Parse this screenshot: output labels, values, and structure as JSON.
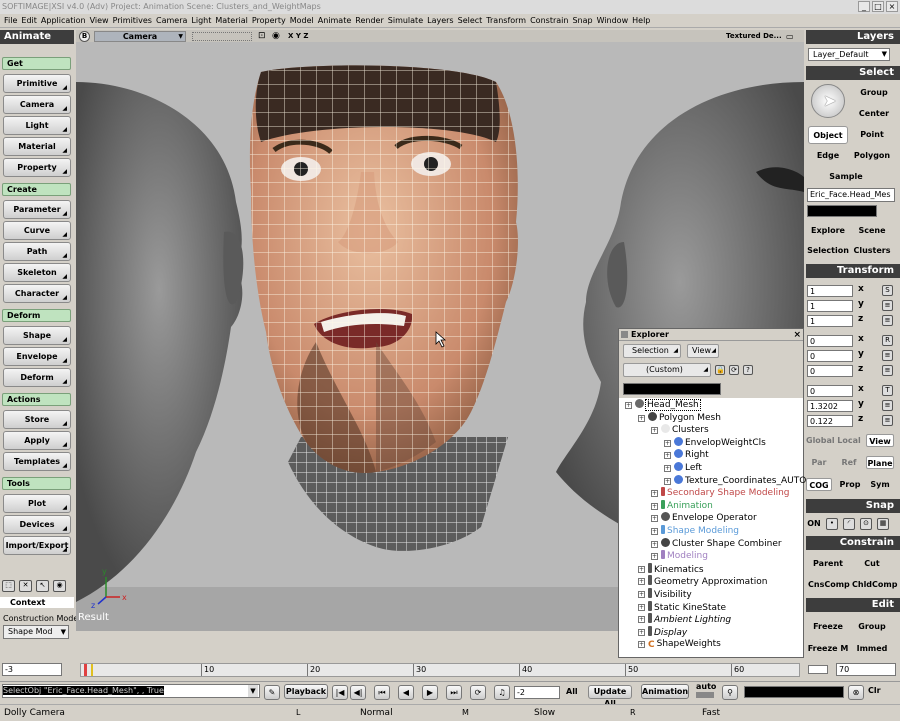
{
  "window": {
    "title": "SOFTIMAGE|XSI v4.0 (Adv) Project: Animation   Scene: Clusters_and_WeightMaps",
    "min": "_",
    "max": "□",
    "close": "×"
  },
  "menu": [
    "File",
    "Edit",
    "Application",
    "View",
    "Primitives",
    "Camera",
    "Light",
    "Material",
    "Property",
    "Model",
    "Animate",
    "Render",
    "Simulate",
    "Layers",
    "Select",
    "Transform",
    "Constrain",
    "Snap",
    "Window",
    "Help"
  ],
  "left": {
    "mode": "Animate",
    "get": {
      "label": "Get",
      "buttons": [
        "Primitive",
        "Camera",
        "Light",
        "Material",
        "Property"
      ]
    },
    "create": {
      "label": "Create",
      "buttons": [
        "Parameter",
        "Curve",
        "Path",
        "Skeleton",
        "Character"
      ]
    },
    "deform": {
      "label": "Deform",
      "buttons": [
        "Shape",
        "Envelope",
        "Deform"
      ]
    },
    "actions": {
      "label": "Actions",
      "buttons": [
        "Store",
        "Apply",
        "Templates"
      ]
    },
    "tools": {
      "label": "Tools",
      "buttons": [
        "Plot",
        "Devices",
        "Import/Export"
      ]
    },
    "context": "Context",
    "construction_mode_label": "Construction Mode",
    "construction_mode_value": "Shape Mod"
  },
  "viewport": {
    "badge": "B",
    "camera": "Camera",
    "xyz": "X Y Z",
    "display": "Textured De...",
    "result": "Result"
  },
  "right": {
    "layers": "Layers",
    "layer_default": "Layer_Default",
    "select": "Select",
    "group": "Group",
    "center": "Center",
    "object": "Object",
    "point": "Point",
    "edge": "Edge",
    "polygon": "Polygon",
    "sample": "Sample",
    "selected_name": "Eric_Face.Head_Mes",
    "explore": "Explore",
    "scene": "Scene",
    "selection": "Selection",
    "clusters": "Clusters",
    "transform": "Transform",
    "scale": [
      "1",
      "1",
      "1"
    ],
    "rotation": [
      "0",
      "0",
      "0"
    ],
    "translation": [
      "0",
      "1.3202",
      "0.122"
    ],
    "axes": [
      "x",
      "y",
      "z"
    ],
    "global": "Global",
    "local": "Local",
    "view": "View",
    "par": "Par",
    "ref": "Ref",
    "plane": "Plane",
    "cog": "COG",
    "prop": "Prop",
    "sym": "Sym",
    "snap": "Snap",
    "on": "ON",
    "constrain": "Constrain",
    "parent": "Parent",
    "cut": "Cut",
    "cnscomp": "CnsComp",
    "chldcomp": "ChldComp",
    "edit": "Edit",
    "freeze": "Freeze",
    "group2": "Group",
    "freeze_m": "Freeze M",
    "immed": "Immed"
  },
  "explorer": {
    "title": "Explorer",
    "selection": "Selection",
    "view": "View",
    "filter": "(Custom)",
    "tree": [
      {
        "label": "Head_Mesh",
        "indent": 0,
        "color": "#000000",
        "icon": "model-icon",
        "selected": true
      },
      {
        "label": "Polygon Mesh",
        "indent": 1,
        "color": "#000000",
        "icon": "gear-icon"
      },
      {
        "label": "Clusters",
        "indent": 2,
        "color": "#000000",
        "icon": "folder-icon"
      },
      {
        "label": "EnvelopWeightCls",
        "indent": 3,
        "color": "#000000",
        "icon": "cluster-icon"
      },
      {
        "label": "Right",
        "indent": 3,
        "color": "#000000",
        "icon": "cluster-icon"
      },
      {
        "label": "Left",
        "indent": 3,
        "color": "#000000",
        "icon": "cluster-icon"
      },
      {
        "label": "Texture_Coordinates_AUTO",
        "indent": 3,
        "color": "#000000",
        "icon": "cluster-icon"
      },
      {
        "label": "Secondary Shape Modeling",
        "indent": 2,
        "color": "#c04848",
        "icon": "marker-icon"
      },
      {
        "label": "Animation",
        "indent": 2,
        "color": "#3aa05a",
        "icon": "marker-icon"
      },
      {
        "label": "Envelope Operator",
        "indent": 2,
        "color": "#000000",
        "icon": "operator-icon"
      },
      {
        "label": "Shape Modeling",
        "indent": 2,
        "color": "#5a9ad8",
        "icon": "marker-icon"
      },
      {
        "label": "Cluster Shape Combiner",
        "indent": 2,
        "color": "#000000",
        "icon": "gear-icon"
      },
      {
        "label": "Modeling",
        "indent": 2,
        "color": "#a080c0",
        "icon": "marker-icon"
      },
      {
        "label": "Kinematics",
        "indent": 1,
        "color": "#000000",
        "icon": "prop-icon"
      },
      {
        "label": "Geometry Approximation",
        "indent": 1,
        "color": "#000000",
        "icon": "prop-icon"
      },
      {
        "label": "Visibility",
        "indent": 1,
        "color": "#000000",
        "icon": "prop-icon"
      },
      {
        "label": "Static KineState",
        "indent": 1,
        "color": "#000000",
        "icon": "prop-icon"
      },
      {
        "label": "Ambient Lighting",
        "indent": 1,
        "color": "#000000",
        "icon": "prop-icon",
        "italic": true
      },
      {
        "label": "Display",
        "indent": 1,
        "color": "#000000",
        "icon": "prop-icon",
        "italic": true
      },
      {
        "label": "ShapeWeights",
        "indent": 1,
        "color": "#000000",
        "icon": "c-icon"
      }
    ]
  },
  "timeline": {
    "start": "-3",
    "ticks": [
      "10",
      "20",
      "30",
      "40",
      "50",
      "60",
      "70"
    ],
    "end": "70"
  },
  "command": {
    "script": "SelectObj \"Eric_Face.Head_Mesh\", , True",
    "playback": "Playback",
    "frame": "-2",
    "all": "All",
    "update_all": "Update All",
    "animation": "Animation",
    "auto": "auto",
    "clr": "Clr"
  },
  "status": {
    "tool": "Dolly Camera",
    "l_key": "L",
    "l_action": "Normal",
    "m_key": "M",
    "m_action": "Slow",
    "r_key": "R",
    "r_action": "Fast"
  }
}
